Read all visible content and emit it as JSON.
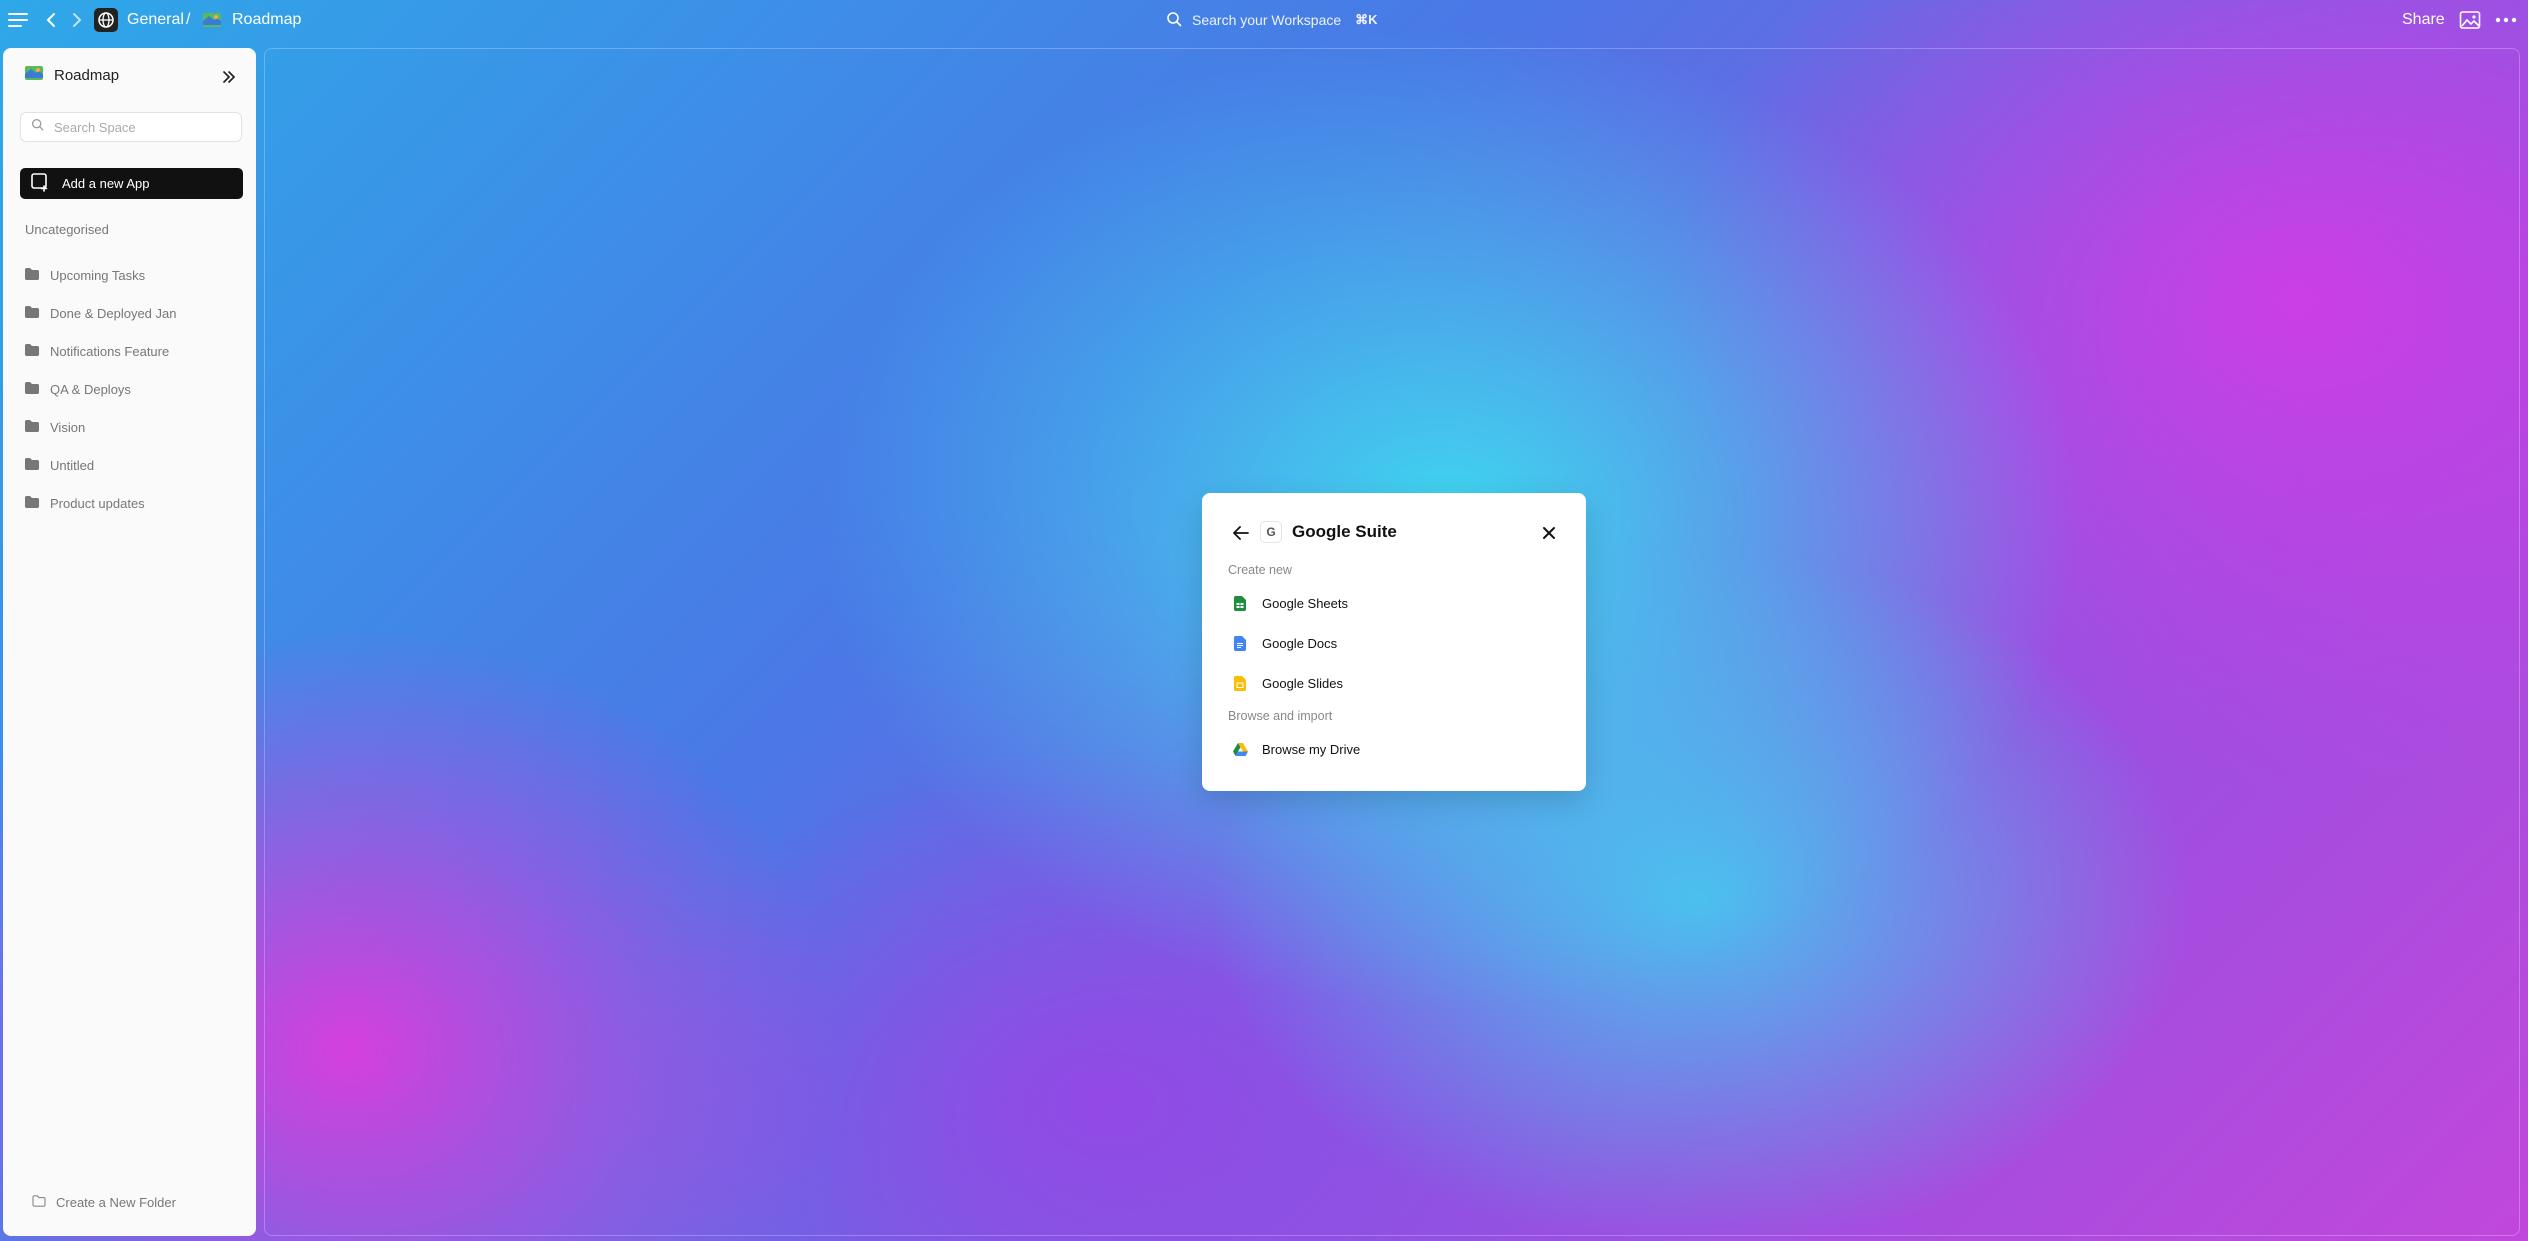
{
  "topbar": {
    "breadcrumb_workspace": "General",
    "breadcrumb_separator": "/",
    "breadcrumb_page": "Roadmap",
    "search_label": "Search your Workspace",
    "search_shortcut": "⌘K",
    "share_label": "Share"
  },
  "sidebar": {
    "title": "Roadmap",
    "search_placeholder": "Search Space",
    "add_app_label": "Add a new App",
    "section_label": "Uncategorised",
    "folders": [
      "Upcoming Tasks",
      "Done & Deployed Jan",
      "Notifications Feature",
      "QA & Deploys",
      "Vision",
      "Untitled",
      "Product updates"
    ],
    "new_folder_label": "Create a New Folder"
  },
  "modal": {
    "title": "Google Suite",
    "logo_letter": "G",
    "create_section": "Create new",
    "create_items": [
      "Google Sheets",
      "Google Docs",
      "Google Slides"
    ],
    "browse_section": "Browse and import",
    "browse_item": "Browse my Drive"
  },
  "colors": {
    "sheets": "#1e8e3e",
    "docs": "#4285f4",
    "slides": "#fbbc04",
    "sidebar_bg": "#fafafa",
    "add_app_bg": "#111111"
  }
}
